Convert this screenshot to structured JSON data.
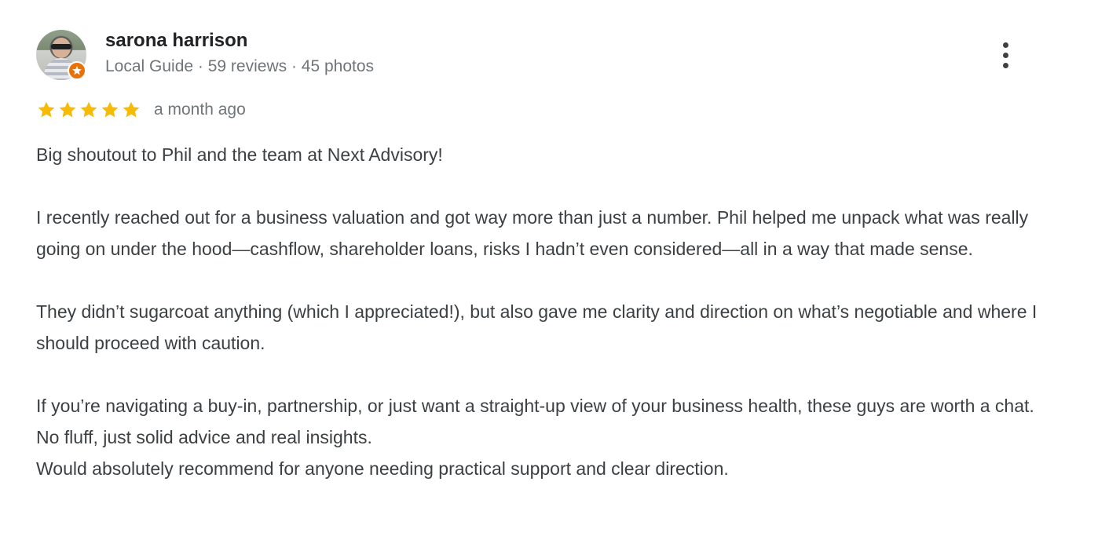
{
  "reviewer": {
    "name": "sarona harrison",
    "meta": "Local Guide · 59 reviews · 45 photos",
    "badge_icon": "local-guide-star-icon",
    "badge_color": "#e8710a"
  },
  "rating": {
    "stars": 5,
    "max_stars": 5,
    "star_color": "#f6bb06",
    "time": "a month ago"
  },
  "review": {
    "paragraph_1": "Big shoutout to Phil and the team at Next Advisory!",
    "paragraph_2": "I recently reached out for a business valuation and got way more than just a number. Phil helped me unpack what was really going on under the hood—cashflow, shareholder loans, risks I hadn’t even considered—all in a way that made sense.",
    "paragraph_3": "They didn’t sugarcoat anything (which I appreciated!), but also gave me clarity and direction on what’s negotiable and where I should proceed with caution.",
    "paragraph_4_line_1": "If you’re navigating a buy-in, partnership, or just want a straight-up view of your business health, these guys are worth a chat. No fluff, just solid advice and real insights.",
    "paragraph_4_line_2": "Would absolutely recommend for anyone needing practical support and clear direction."
  },
  "actions": {
    "more_icon": "more-vertical-icon"
  }
}
